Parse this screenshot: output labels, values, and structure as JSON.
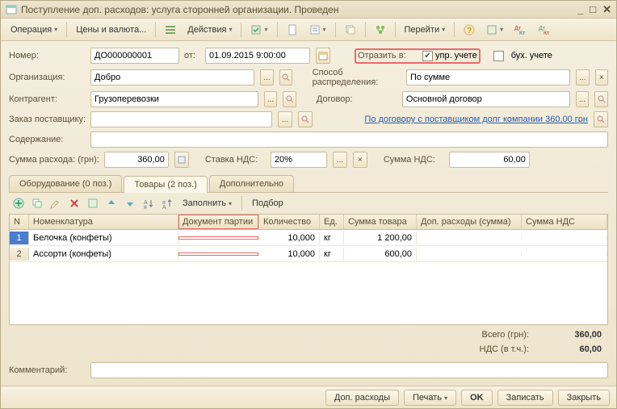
{
  "window": {
    "title": "Поступление доп. расходов: услуга сторонней организации. Проведен"
  },
  "toolbar": {
    "operation": "Операция",
    "prices": "Цены и валюта...",
    "actions": "Действия",
    "goto": "Перейти"
  },
  "form": {
    "number_lbl": "Номер:",
    "number": "ДО000000001",
    "from_lbl": "от:",
    "date": "01.09.2015  9:00:00",
    "reflect_lbl": "Отразить в:",
    "upr_chk": "упр. учете",
    "buh_chk": "бух. учете",
    "org_lbl": "Организация:",
    "org": "Добро",
    "method_lbl": "Способ распределения:",
    "method": "По сумме",
    "contr_lbl": "Контрагент:",
    "contr": "Грузоперевозки",
    "contract_lbl": "Договор:",
    "contract": "Основной договор",
    "order_lbl": "Заказ поставщику:",
    "debt_link": "По договору с поставщиком долг компании 360,00 грн",
    "content_lbl": "Содержание:",
    "sum_lbl": "Сумма расхода: (грн):",
    "sum": "360,00",
    "vat_rate_lbl": "Ставка НДС:",
    "vat_rate": "20%",
    "vat_sum_lbl": "Сумма НДС:",
    "vat_sum": "60,00",
    "comment_lbl": "Комментарий:"
  },
  "tabs": {
    "t0": "Оборудование (0 поз.)",
    "t1": "Товары (2 поз.)",
    "t2": "Дополнительно"
  },
  "tabtb": {
    "fill": "Заполнить",
    "select": "Подбор"
  },
  "grid": {
    "cols": {
      "n": "N",
      "nom": "Номенклатура",
      "doc": "Документ партии",
      "qty": "Количество",
      "unit": "Ед.",
      "sum": "Сумма товара",
      "add": "Доп. расходы (сумма)",
      "vat": "Сумма НДС"
    },
    "rows": [
      {
        "n": "1",
        "nom": "Белочка (конфеты)",
        "doc": "",
        "qty": "10,000",
        "unit": "кг",
        "sum": "1 200,00",
        "add": "",
        "vat": ""
      },
      {
        "n": "2",
        "nom": "Ассорти (конфеты)",
        "doc": "",
        "qty": "10,000",
        "unit": "кг",
        "sum": "600,00",
        "add": "",
        "vat": ""
      }
    ]
  },
  "totals": {
    "total_lbl": "Всего (грн):",
    "total": "360,00",
    "vat_lbl": "НДС (в т.ч.):",
    "vat": "60,00"
  },
  "footer": {
    "extra": "Доп. расходы",
    "print": "Печать",
    "ok": "OK",
    "save": "Записать",
    "close": "Закрыть"
  }
}
